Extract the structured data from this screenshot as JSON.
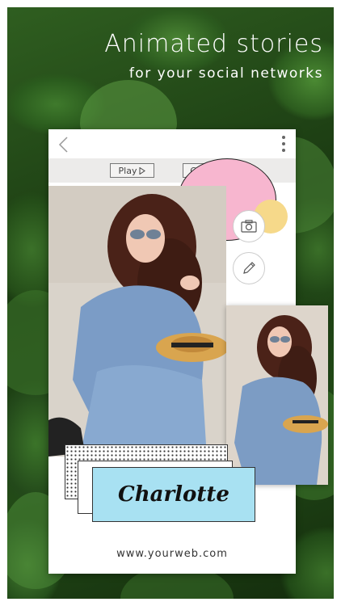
{
  "headline": {
    "title": "Animated stories",
    "subtitle": "for your social networks"
  },
  "card": {
    "toolbar": {
      "play_label": "Play",
      "create_label": "Create"
    },
    "story_name": "Charlotte",
    "website": "www.yourweb.com"
  },
  "icons": {
    "back": "chevron-left-icon",
    "more": "more-vertical-icon",
    "play": "play-triangle-icon",
    "camera": "camera-icon",
    "pencil": "pencil-icon"
  },
  "colors": {
    "pink_bubble": "#f7b6cf",
    "yellow_bubble": "#f6d98a",
    "name_plate": "#a8e1f2",
    "toolbar_bg": "#ecebea"
  }
}
